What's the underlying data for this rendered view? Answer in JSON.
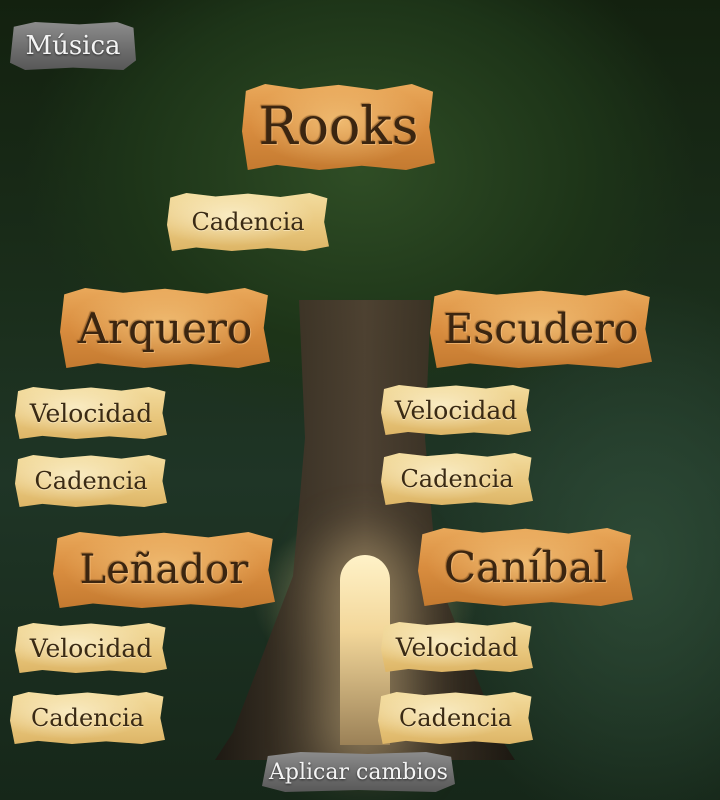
{
  "top_button": {
    "music_label": "Música"
  },
  "root": {
    "title": "Rooks",
    "cadence_label": "Cadencia"
  },
  "left_branch": {
    "arquero": {
      "title": "Arquero",
      "speed_label": "Velocidad",
      "cadence_label": "Cadencia"
    },
    "lenador": {
      "title": "Leñador",
      "speed_label": "Velocidad",
      "cadence_label": "Cadencia"
    }
  },
  "right_branch": {
    "escudero": {
      "title": "Escudero",
      "speed_label": "Velocidad",
      "cadence_label": "Cadencia"
    },
    "canibal": {
      "title": "Caníbal",
      "speed_label": "Velocidad",
      "cadence_label": "Cadencia"
    }
  },
  "bottom_button": {
    "apply_label": "Aplicar cambios"
  }
}
